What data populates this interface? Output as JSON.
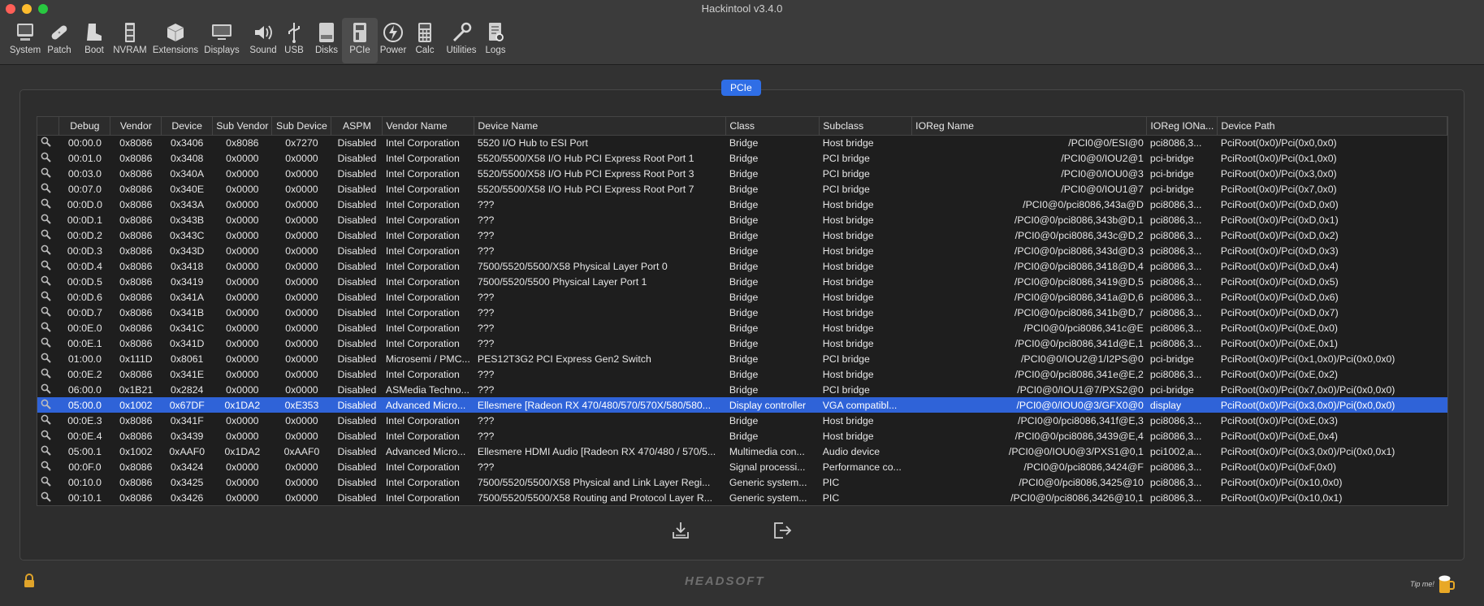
{
  "window": {
    "title": "Hackintool v3.4.0"
  },
  "toolbar": {
    "items": [
      {
        "label": "System",
        "icon": "system-icon"
      },
      {
        "label": "Patch",
        "icon": "patch-icon"
      },
      {
        "label": "Boot",
        "icon": "boot-icon"
      },
      {
        "label": "NVRAM",
        "icon": "nvram-icon"
      },
      {
        "label": "Extensions",
        "icon": "extensions-icon"
      },
      {
        "label": "Displays",
        "icon": "displays-icon"
      },
      {
        "label": "Sound",
        "icon": "sound-icon"
      },
      {
        "label": "USB",
        "icon": "usb-icon"
      },
      {
        "label": "Disks",
        "icon": "disks-icon"
      },
      {
        "label": "PCIe",
        "icon": "pcie-icon",
        "active": true
      },
      {
        "label": "Power",
        "icon": "power-icon"
      },
      {
        "label": "Calc",
        "icon": "calc-icon"
      },
      {
        "label": "Utilities",
        "icon": "utilities-icon"
      },
      {
        "label": "Logs",
        "icon": "logs-icon"
      }
    ]
  },
  "panel": {
    "tab_label": "PCIe"
  },
  "table": {
    "columns": [
      "",
      "Debug",
      "Vendor",
      "Device",
      "Sub Vendor",
      "Sub Device",
      "ASPM",
      "Vendor Name",
      "Device Name",
      "Class",
      "Subclass",
      "IOReg Name",
      "IOReg IONa...",
      "Device Path"
    ],
    "rows": [
      [
        "00:00.0",
        "0x8086",
        "0x3406",
        "0x8086",
        "0x7270",
        "Disabled",
        "Intel Corporation",
        "5520 I/O Hub to ESI Port",
        "Bridge",
        "Host bridge",
        "/PCI0@0/ESI@0",
        "pci8086,3...",
        "PciRoot(0x0)/Pci(0x0,0x0)"
      ],
      [
        "00:01.0",
        "0x8086",
        "0x3408",
        "0x0000",
        "0x0000",
        "Disabled",
        "Intel Corporation",
        "5520/5500/X58 I/O Hub PCI Express Root Port 1",
        "Bridge",
        "PCI bridge",
        "/PCI0@0/IOU2@1",
        "pci-bridge",
        "PciRoot(0x0)/Pci(0x1,0x0)"
      ],
      [
        "00:03.0",
        "0x8086",
        "0x340A",
        "0x0000",
        "0x0000",
        "Disabled",
        "Intel Corporation",
        "5520/5500/X58 I/O Hub PCI Express Root Port 3",
        "Bridge",
        "PCI bridge",
        "/PCI0@0/IOU0@3",
        "pci-bridge",
        "PciRoot(0x0)/Pci(0x3,0x0)"
      ],
      [
        "00:07.0",
        "0x8086",
        "0x340E",
        "0x0000",
        "0x0000",
        "Disabled",
        "Intel Corporation",
        "5520/5500/X58 I/O Hub PCI Express Root Port 7",
        "Bridge",
        "PCI bridge",
        "/PCI0@0/IOU1@7",
        "pci-bridge",
        "PciRoot(0x0)/Pci(0x7,0x0)"
      ],
      [
        "00:0D.0",
        "0x8086",
        "0x343A",
        "0x0000",
        "0x0000",
        "Disabled",
        "Intel Corporation",
        "???",
        "Bridge",
        "Host bridge",
        "/PCI0@0/pci8086,343a@D",
        "pci8086,3...",
        "PciRoot(0x0)/Pci(0xD,0x0)"
      ],
      [
        "00:0D.1",
        "0x8086",
        "0x343B",
        "0x0000",
        "0x0000",
        "Disabled",
        "Intel Corporation",
        "???",
        "Bridge",
        "Host bridge",
        "/PCI0@0/pci8086,343b@D,1",
        "pci8086,3...",
        "PciRoot(0x0)/Pci(0xD,0x1)"
      ],
      [
        "00:0D.2",
        "0x8086",
        "0x343C",
        "0x0000",
        "0x0000",
        "Disabled",
        "Intel Corporation",
        "???",
        "Bridge",
        "Host bridge",
        "/PCI0@0/pci8086,343c@D,2",
        "pci8086,3...",
        "PciRoot(0x0)/Pci(0xD,0x2)"
      ],
      [
        "00:0D.3",
        "0x8086",
        "0x343D",
        "0x0000",
        "0x0000",
        "Disabled",
        "Intel Corporation",
        "???",
        "Bridge",
        "Host bridge",
        "/PCI0@0/pci8086,343d@D,3",
        "pci8086,3...",
        "PciRoot(0x0)/Pci(0xD,0x3)"
      ],
      [
        "00:0D.4",
        "0x8086",
        "0x3418",
        "0x0000",
        "0x0000",
        "Disabled",
        "Intel Corporation",
        "7500/5520/5500/X58 Physical Layer Port 0",
        "Bridge",
        "Host bridge",
        "/PCI0@0/pci8086,3418@D,4",
        "pci8086,3...",
        "PciRoot(0x0)/Pci(0xD,0x4)"
      ],
      [
        "00:0D.5",
        "0x8086",
        "0x3419",
        "0x0000",
        "0x0000",
        "Disabled",
        "Intel Corporation",
        "7500/5520/5500 Physical Layer Port 1",
        "Bridge",
        "Host bridge",
        "/PCI0@0/pci8086,3419@D,5",
        "pci8086,3...",
        "PciRoot(0x0)/Pci(0xD,0x5)"
      ],
      [
        "00:0D.6",
        "0x8086",
        "0x341A",
        "0x0000",
        "0x0000",
        "Disabled",
        "Intel Corporation",
        "???",
        "Bridge",
        "Host bridge",
        "/PCI0@0/pci8086,341a@D,6",
        "pci8086,3...",
        "PciRoot(0x0)/Pci(0xD,0x6)"
      ],
      [
        "00:0D.7",
        "0x8086",
        "0x341B",
        "0x0000",
        "0x0000",
        "Disabled",
        "Intel Corporation",
        "???",
        "Bridge",
        "Host bridge",
        "/PCI0@0/pci8086,341b@D,7",
        "pci8086,3...",
        "PciRoot(0x0)/Pci(0xD,0x7)"
      ],
      [
        "00:0E.0",
        "0x8086",
        "0x341C",
        "0x0000",
        "0x0000",
        "Disabled",
        "Intel Corporation",
        "???",
        "Bridge",
        "Host bridge",
        "/PCI0@0/pci8086,341c@E",
        "pci8086,3...",
        "PciRoot(0x0)/Pci(0xE,0x0)"
      ],
      [
        "00:0E.1",
        "0x8086",
        "0x341D",
        "0x0000",
        "0x0000",
        "Disabled",
        "Intel Corporation",
        "???",
        "Bridge",
        "Host bridge",
        "/PCI0@0/pci8086,341d@E,1",
        "pci8086,3...",
        "PciRoot(0x0)/Pci(0xE,0x1)"
      ],
      [
        "01:00.0",
        "0x111D",
        "0x8061",
        "0x0000",
        "0x0000",
        "Disabled",
        "Microsemi / PMC...",
        "PES12T3G2 PCI Express Gen2 Switch",
        "Bridge",
        "PCI bridge",
        "/PCI0@0/IOU2@1/I2PS@0",
        "pci-bridge",
        "PciRoot(0x0)/Pci(0x1,0x0)/Pci(0x0,0x0)"
      ],
      [
        "00:0E.2",
        "0x8086",
        "0x341E",
        "0x0000",
        "0x0000",
        "Disabled",
        "Intel Corporation",
        "???",
        "Bridge",
        "Host bridge",
        "/PCI0@0/pci8086,341e@E,2",
        "pci8086,3...",
        "PciRoot(0x0)/Pci(0xE,0x2)"
      ],
      [
        "06:00.0",
        "0x1B21",
        "0x2824",
        "0x0000",
        "0x0000",
        "Disabled",
        "ASMedia Techno...",
        "???",
        "Bridge",
        "PCI bridge",
        "/PCI0@0/IOU1@7/PXS2@0",
        "pci-bridge",
        "PciRoot(0x0)/Pci(0x7,0x0)/Pci(0x0,0x0)"
      ],
      [
        "05:00.0",
        "0x1002",
        "0x67DF",
        "0x1DA2",
        "0xE353",
        "Disabled",
        "Advanced Micro...",
        "Ellesmere [Radeon RX 470/480/570/570X/580/580...",
        "Display controller",
        "VGA compatibl...",
        "/PCI0@0/IOU0@3/GFX0@0",
        "display",
        "PciRoot(0x0)/Pci(0x3,0x0)/Pci(0x0,0x0)"
      ],
      [
        "00:0E.3",
        "0x8086",
        "0x341F",
        "0x0000",
        "0x0000",
        "Disabled",
        "Intel Corporation",
        "???",
        "Bridge",
        "Host bridge",
        "/PCI0@0/pci8086,341f@E,3",
        "pci8086,3...",
        "PciRoot(0x0)/Pci(0xE,0x3)"
      ],
      [
        "00:0E.4",
        "0x8086",
        "0x3439",
        "0x0000",
        "0x0000",
        "Disabled",
        "Intel Corporation",
        "???",
        "Bridge",
        "Host bridge",
        "/PCI0@0/pci8086,3439@E,4",
        "pci8086,3...",
        "PciRoot(0x0)/Pci(0xE,0x4)"
      ],
      [
        "05:00.1",
        "0x1002",
        "0xAAF0",
        "0x1DA2",
        "0xAAF0",
        "Disabled",
        "Advanced Micro...",
        "Ellesmere HDMI Audio [Radeon RX 470/480 / 570/5...",
        "Multimedia con...",
        "Audio device",
        "/PCI0@0/IOU0@3/PXS1@0,1",
        "pci1002,a...",
        "PciRoot(0x0)/Pci(0x3,0x0)/Pci(0x0,0x1)"
      ],
      [
        "00:0F.0",
        "0x8086",
        "0x3424",
        "0x0000",
        "0x0000",
        "Disabled",
        "Intel Corporation",
        "???",
        "Signal processi...",
        "Performance co...",
        "/PCI0@0/pci8086,3424@F",
        "pci8086,3...",
        "PciRoot(0x0)/Pci(0xF,0x0)"
      ],
      [
        "00:10.0",
        "0x8086",
        "0x3425",
        "0x0000",
        "0x0000",
        "Disabled",
        "Intel Corporation",
        "7500/5520/5500/X58 Physical and Link Layer Regi...",
        "Generic system...",
        "PIC",
        "/PCI0@0/pci8086,3425@10",
        "pci8086,3...",
        "PciRoot(0x0)/Pci(0x10,0x0)"
      ],
      [
        "00:10.1",
        "0x8086",
        "0x3426",
        "0x0000",
        "0x0000",
        "Disabled",
        "Intel Corporation",
        "7500/5520/5500/X58 Routing and Protocol Layer R...",
        "Generic system...",
        "PIC",
        "/PCI0@0/pci8086,3426@10,1",
        "pci8086,3...",
        "PciRoot(0x0)/Pci(0x10,0x1)"
      ]
    ],
    "selected_row": 17
  },
  "footer": {
    "brand": "HEADSOFT",
    "tip_label": "Tip me!"
  },
  "colors": {
    "selection": "#2f63d8",
    "accent": "#2f6ee6"
  }
}
